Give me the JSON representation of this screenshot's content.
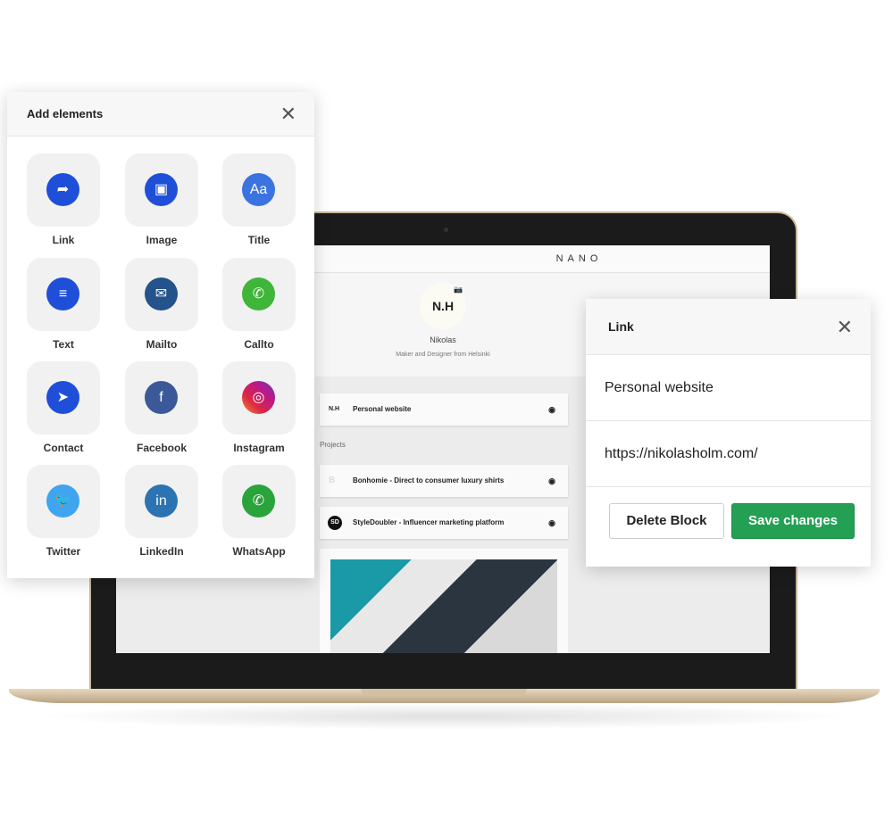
{
  "laptop": {
    "brand": "NANO",
    "avatar": "N.H",
    "name": "Nikolas",
    "bio": "Maker and Designer from Helsinki",
    "section": "Projects",
    "cards": [
      {
        "icon": "N.H",
        "label": "Personal website"
      },
      {
        "icon": "B",
        "label": "Bonhomie - Direct to consumer luxury shirts"
      },
      {
        "icon": "SD",
        "label": "StyleDoubler - Influencer marketing platform"
      }
    ]
  },
  "add_panel": {
    "title": "Add elements",
    "items": [
      {
        "label": "Link",
        "icon": "share-arrow-icon",
        "color": "#1f4fd8",
        "glyph": "➦"
      },
      {
        "label": "Image",
        "icon": "image-icon",
        "color": "#1f4fd8",
        "glyph": "▣"
      },
      {
        "label": "Title",
        "icon": "text-aa-icon",
        "color": "#3b73e0",
        "glyph": "Aa"
      },
      {
        "label": "Text",
        "icon": "text-lines-icon",
        "color": "#1f4fd8",
        "glyph": "≡"
      },
      {
        "label": "Mailto",
        "icon": "envelope-icon",
        "color": "#24528a",
        "glyph": "✉"
      },
      {
        "label": "Callto",
        "icon": "phone-icon",
        "color": "#3fb53a",
        "glyph": "✆"
      },
      {
        "label": "Contact",
        "icon": "send-icon",
        "color": "#1f4fd8",
        "glyph": "➤"
      },
      {
        "label": "Facebook",
        "icon": "facebook-icon",
        "color": "#3b5998",
        "glyph": "f"
      },
      {
        "label": "Instagram",
        "icon": "instagram-icon",
        "color": "#c13584",
        "glyph": "◎"
      },
      {
        "label": "Twitter",
        "icon": "twitter-icon",
        "color": "#3fa5ee",
        "glyph": "🐦"
      },
      {
        "label": "LinkedIn",
        "icon": "linkedin-icon",
        "color": "#2b74b1",
        "glyph": "in"
      },
      {
        "label": "WhatsApp",
        "icon": "whatsapp-icon",
        "color": "#2aa33a",
        "glyph": "✆"
      }
    ]
  },
  "link_panel": {
    "title": "Link",
    "label_value": "Personal website",
    "url_value": "https://nikolasholm.com/",
    "delete": "Delete Block",
    "save": "Save changes"
  }
}
